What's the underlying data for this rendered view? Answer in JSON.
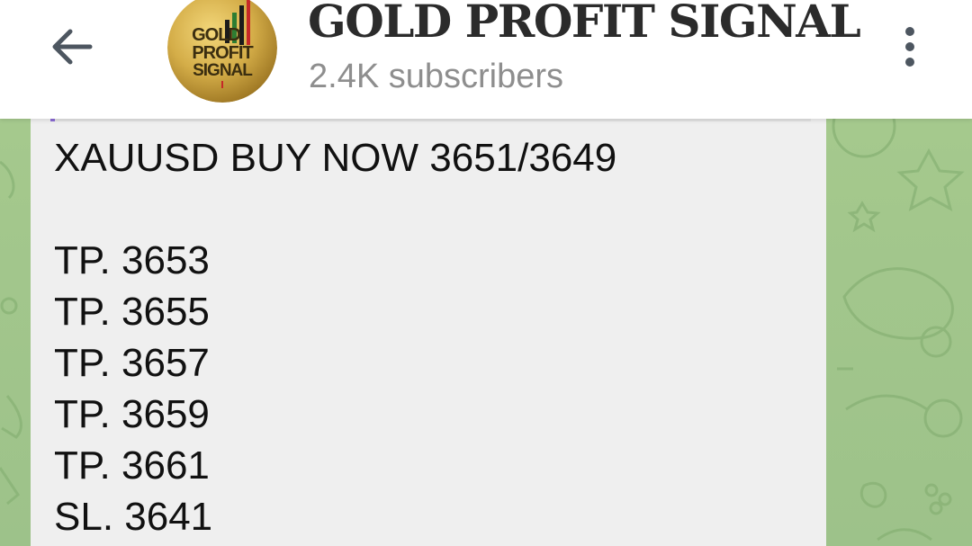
{
  "header": {
    "channel_name": "GOLD PROFIT SIGNAL",
    "subscribers": "2.4K subscribers",
    "avatar_text": [
      "GOLD",
      "PROFIT",
      "SIGNAL"
    ],
    "back_icon": "arrow-left-icon",
    "menu_icon": "more-vertical-icon"
  },
  "message": {
    "lines": [
      "XAUUSD BUY NOW 3651/3649",
      "TP. 3653",
      "TP. 3655",
      "TP. 3657",
      "TP. 3659",
      "TP. 3661",
      "SL. 3641"
    ]
  },
  "colors": {
    "header_bg": "#ffffff",
    "title": "#2b2b2b",
    "subtitle": "#8e8e8e",
    "bubble_bg": "#efefef",
    "wallpaper": "#a3c78c",
    "accent": "#8a6ad4",
    "avatar_gold": "#c9a43a"
  }
}
